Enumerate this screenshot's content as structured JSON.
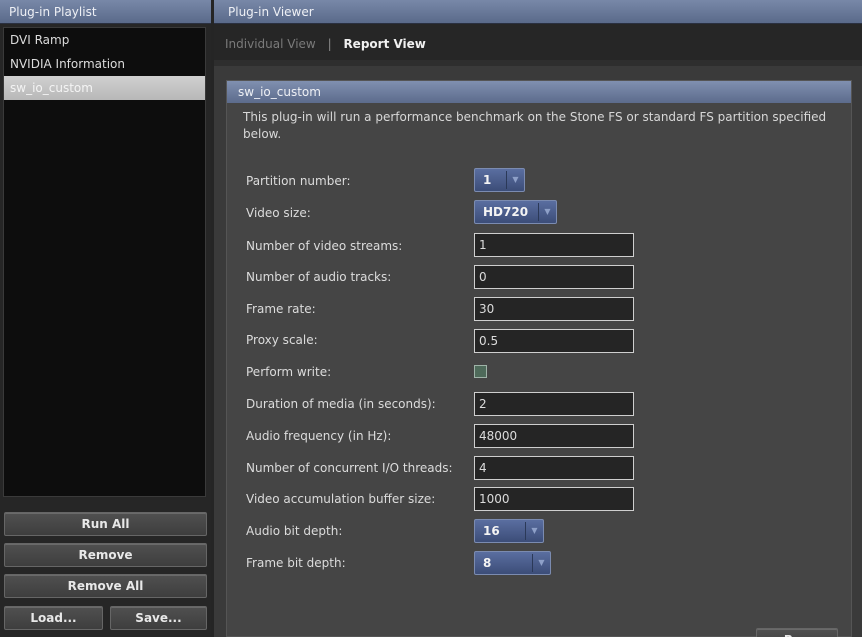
{
  "left_panel": {
    "title": "Plug-in Playlist",
    "items": [
      {
        "label": "DVI Ramp",
        "selected": false
      },
      {
        "label": "NVIDIA Information",
        "selected": false
      },
      {
        "label": "sw_io_custom",
        "selected": true
      }
    ],
    "buttons": {
      "run_all": "Run All",
      "remove": "Remove",
      "remove_all": "Remove All",
      "load": "Load...",
      "save": "Save..."
    }
  },
  "right_panel": {
    "title": "Plug-in Viewer",
    "tabs": {
      "individual": "Individual View",
      "separator": "|",
      "report": "Report View"
    },
    "plugin": {
      "name": "sw_io_custom",
      "description": "This plug-in will run a performance benchmark on the Stone FS or standard FS partition specified below.",
      "fields": {
        "partition_number": {
          "label": "Partition number:",
          "value": "1"
        },
        "video_size": {
          "label": "Video size:",
          "value": "HD720"
        },
        "video_streams": {
          "label": "Number of video streams:",
          "value": "1"
        },
        "audio_tracks": {
          "label": "Number of audio tracks:",
          "value": "0"
        },
        "frame_rate": {
          "label": "Frame rate:",
          "value": "30"
        },
        "proxy_scale": {
          "label": "Proxy scale:",
          "value": "0.5"
        },
        "perform_write": {
          "label": "Perform write:",
          "checked": false
        },
        "duration": {
          "label": "Duration of media (in seconds):",
          "value": "2"
        },
        "audio_frequency": {
          "label": "Audio frequency (in Hz):",
          "value": "48000"
        },
        "io_threads": {
          "label": "Number of concurrent I/O threads:",
          "value": "4"
        },
        "buffer_size": {
          "label": "Video accumulation buffer size:",
          "value": "1000"
        },
        "audio_bit_depth": {
          "label": "Audio bit depth:",
          "value": "16"
        },
        "frame_bit_depth": {
          "label": "Frame bit depth:",
          "value": "8"
        }
      },
      "run_label": "Run"
    }
  },
  "colors": {
    "header_blue": "#6878a0",
    "dropdown_blue": "#4a5c8c",
    "panel_bg": "#454545"
  }
}
